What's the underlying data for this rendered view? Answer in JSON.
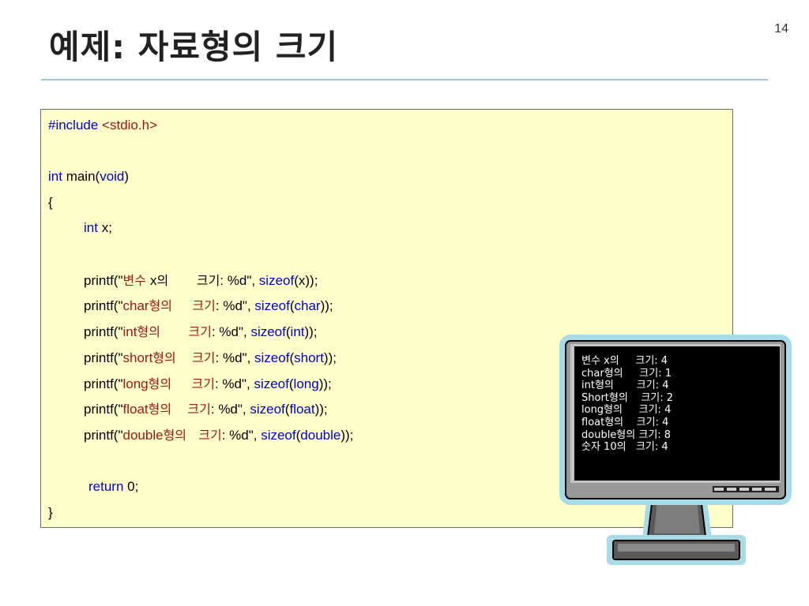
{
  "slide": {
    "title": "예제: 자료형의 크기",
    "page_number": "14"
  },
  "code": {
    "l1_kw": "#include",
    "l1_rest": " <stdio.h>",
    "l3_int": "int",
    "l3_main": " main(",
    "l3_void": "void",
    "l3_close": ")",
    "l4": "{",
    "l5_int": "int",
    "l5_rest": " x;",
    "p1_a": "printf(\"",
    "p1_kr": "변수 ",
    "p1_b": "x",
    "p1_kr2": "의       크기",
    "p1_c": ": %d\", ",
    "p1_sizeof": "sizeof",
    "p1_d": "(x));",
    "p2_a": "printf(\"",
    "p2_t": "char",
    "p2_kr": "형의     크기",
    "p2_c": ": %d\", ",
    "p2_sizeof": "sizeof",
    "p2_d": "(",
    "p2_arg": "char",
    "p2_e": "));",
    "p3_a": "printf(\"",
    "p3_t": "int",
    "p3_kr": "형의       크기",
    "p3_c": ": %d\", ",
    "p3_sizeof": "sizeof",
    "p3_d": "(",
    "p3_arg": "int",
    "p3_e": "));",
    "p4_a": "printf(\"",
    "p4_t": "short",
    "p4_kr": "형의    크기",
    "p4_c": ": %d\", ",
    "p4_sizeof": "sizeof",
    "p4_d": "(",
    "p4_arg": "short",
    "p4_e": "));",
    "p5_a": "printf(\"",
    "p5_t": "long",
    "p5_kr": "형의     크기",
    "p5_c": ": %d\", ",
    "p5_sizeof": "sizeof",
    "p5_d": "(",
    "p5_arg": "long",
    "p5_e": "));",
    "p6_a": "printf(\"",
    "p6_t": "float",
    "p6_kr": "형의    크기",
    "p6_c": ": %d\", ",
    "p6_sizeof": "sizeof",
    "p6_d": "(",
    "p6_arg": "float",
    "p6_e": "));",
    "p7_a": "printf(\"",
    "p7_t": "double",
    "p7_kr": "형의   크기",
    "p7_c": ": %d\", ",
    "p7_sizeof": "sizeof",
    "p7_d": "(",
    "p7_arg": "double",
    "p7_e": "));",
    "ret_kw": "return",
    "ret_rest": " 0;",
    "close": "}"
  },
  "console_output": [
    "변수 x의     크기: 4",
    "char형의     크기: 1",
    "int형의       크기: 4",
    "Short형의    크기: 2",
    "long형의     크기: 4",
    "float형의    크기: 4",
    "double형의 크기: 8",
    "숫자 10의   크기: 4"
  ],
  "colors": {
    "keyword": "#0000cc",
    "string": "#a31515",
    "code_background": "#ffffcc",
    "title_rule": "#a9c1dc",
    "monitor_frame": "#a7dbe7"
  }
}
